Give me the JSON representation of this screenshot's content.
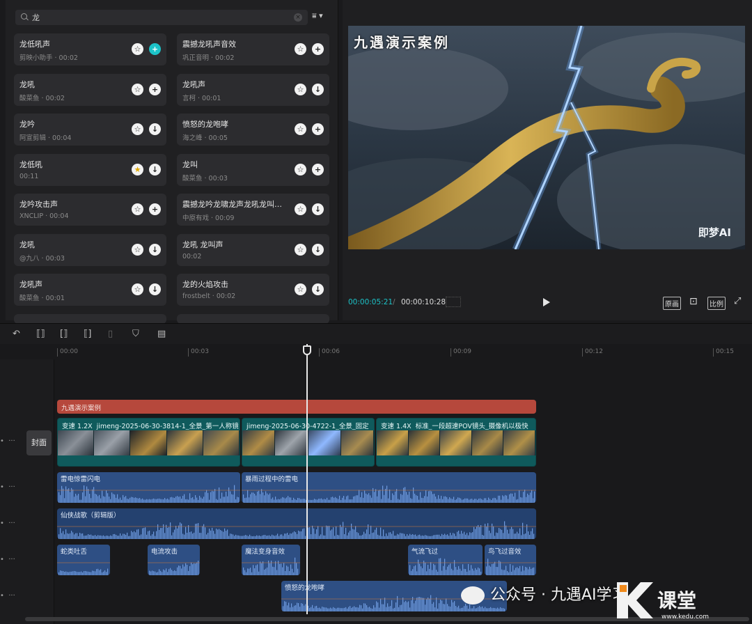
{
  "library": {
    "search_value": "龙",
    "filter_icon": "filter-sort-icon",
    "cards": [
      {
        "name": "龙低吼声",
        "meta": "剪映小助手 · 00:02",
        "starred": false,
        "action": "add",
        "highlight": true
      },
      {
        "name": "震撼龙吼声音效",
        "meta": "巩正音明 · 00:02",
        "starred": false,
        "action": "add",
        "highlight": false
      },
      {
        "name": "龙吼",
        "meta": "酸菜鱼 · 00:02",
        "starred": false,
        "action": "add",
        "highlight": false
      },
      {
        "name": "龙吼声",
        "meta": "言柯 · 00:01",
        "starred": false,
        "action": "download",
        "highlight": false
      },
      {
        "name": "龙吟",
        "meta": "阿宣剪辑 · 00:04",
        "starred": false,
        "action": "download",
        "highlight": false
      },
      {
        "name": "愤怒的龙咆哮",
        "meta": "海之峰 · 00:05",
        "starred": false,
        "action": "add",
        "highlight": false
      },
      {
        "name": "龙低吼",
        "meta": "00:11",
        "starred": true,
        "action": "download",
        "highlight": false
      },
      {
        "name": "龙叫",
        "meta": "酸菜鱼 · 00:03",
        "starred": false,
        "action": "add",
        "highlight": false
      },
      {
        "name": "龙吟攻击声",
        "meta": "XNCLIP · 00:04",
        "starred": false,
        "action": "add",
        "highlight": false
      },
      {
        "name": "震撼龙吟龙啸龙声龙吼龙叫龙...",
        "meta": "中原有戏 · 00:09",
        "starred": false,
        "action": "download",
        "highlight": false
      },
      {
        "name": "龙吼",
        "meta": "@九八 · 00:03",
        "starred": false,
        "action": "download",
        "highlight": false
      },
      {
        "name": "龙吼 龙叫声",
        "meta": "00:02",
        "starred": false,
        "action": "download",
        "highlight": false
      },
      {
        "name": "龙吼声",
        "meta": "酸菜鱼 · 00:01",
        "starred": false,
        "action": "download",
        "highlight": false
      },
      {
        "name": "龙的火焰攻击",
        "meta": "frostbelt · 00:02",
        "starred": false,
        "action": "download",
        "highlight": false
      }
    ]
  },
  "preview": {
    "overlay_title": "九遇演示案例",
    "watermark": "即梦AI",
    "current_time": "00:00:05:21",
    "separator": "/",
    "total_time": "00:00:10:28",
    "btn_original": "原画",
    "btn_ratio": "比例"
  },
  "toolbar": {
    "icons": [
      "undo-icon",
      "split-icon",
      "split-left-icon",
      "split-right-icon",
      "delete-icon",
      "marker-icon",
      "caption-icon"
    ]
  },
  "timeline": {
    "ruler": [
      "00:00",
      "00:03",
      "00:06",
      "00:09",
      "00:12",
      "00:15"
    ],
    "cover_label": "封面",
    "text_clip": "九遇演示案例",
    "video_clips": [
      {
        "speed": "变速 1.2X",
        "title": "jimeng-2025-06-30-3814-1_全景_第一人称镜"
      },
      {
        "speed": "",
        "title": "jimeng-2025-06-30-4722-1_全景_固定"
      },
      {
        "speed": "变速 1.4X",
        "title": "标准_一段超速POV镜头_摄像机以极快"
      }
    ],
    "audio_track1": [
      "雷电惊雷闪电",
      "暴雨过程中的雷电"
    ],
    "audio_track2": [
      "仙侠战歌（剪辑版）"
    ],
    "audio_track3": [
      "蛇类吐舌",
      "电流攻击",
      "魔法变身音效",
      "气流飞过",
      "鸟飞过音效"
    ],
    "audio_track4": [
      "愤怒的龙咆哮"
    ]
  },
  "overlay": {
    "wechat_text": "公众号 · 九遇AI学习",
    "site": "www.kedu.com"
  }
}
